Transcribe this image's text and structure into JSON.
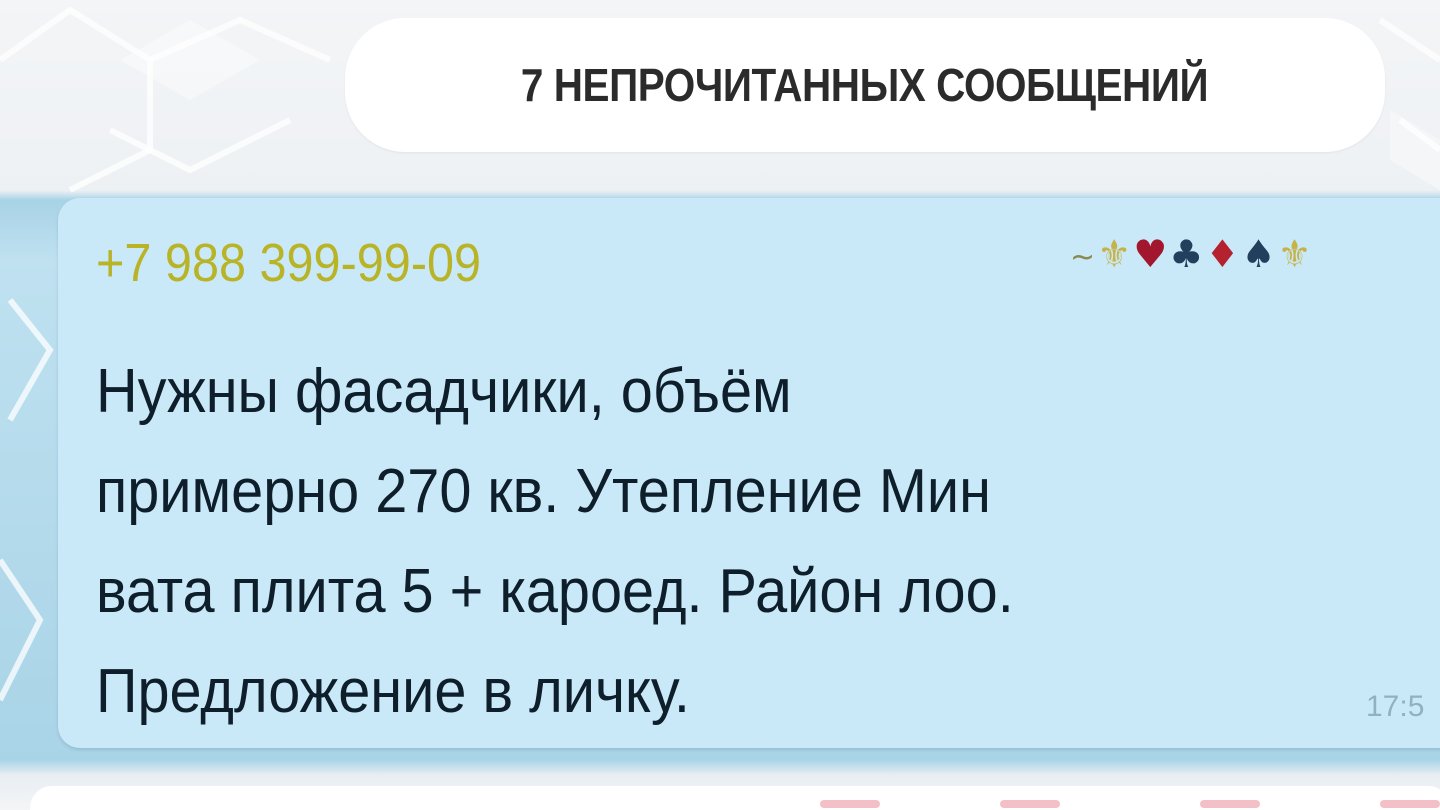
{
  "chat": {
    "unread_separator": "7 НЕПРОЧИТАННЫХ СООБЩЕНИЙ",
    "message": {
      "sender": "+7 988 399-99-09",
      "sender_color": "#b8b327",
      "status_emoji": {
        "tilde": "~",
        "fleur": "⚜",
        "heart": "♥",
        "club": "♣",
        "diamond": "♦",
        "spade": "♠",
        "fleur_end": "⚜"
      },
      "lines": [
        "Нужны фасадчики, объём",
        "примерно 270 кв. Утепление Мин",
        "вата плита 5 + кароед. Район лоо.",
        "Предложение в личку."
      ],
      "time": "17:5",
      "bubble_color": "#c9e9f8"
    }
  }
}
